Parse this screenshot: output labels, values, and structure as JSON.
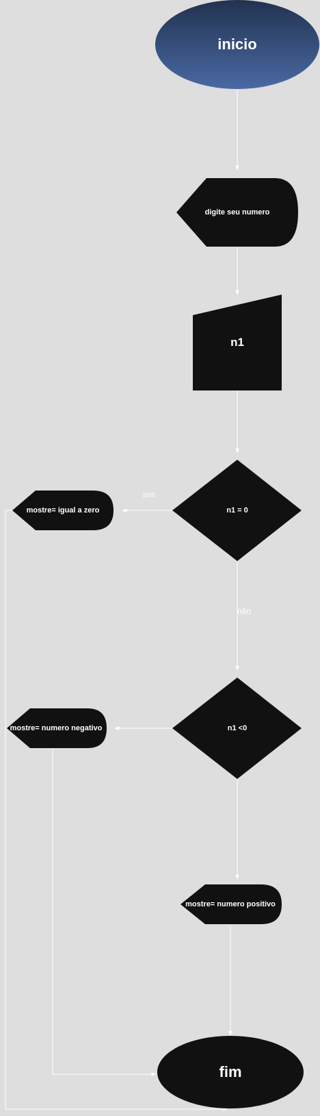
{
  "nodes": {
    "start": "inicio",
    "prompt": "digite seu numero",
    "input": "n1",
    "decision1": "n1 = 0",
    "output_zero": "mostre= igual a zero",
    "decision2": "n1 <0",
    "output_negative": "mostre= numero  negativo",
    "output_positive": "mostre= numero positivo",
    "end": "fim"
  },
  "edges": {
    "yes_label": "sim",
    "no_label": "não"
  },
  "colors": {
    "background": "#dedede",
    "start_fill_top": "#233654",
    "start_fill_bottom": "#4a69a3",
    "node_fill": "#111111",
    "connector": "#ffffff"
  }
}
